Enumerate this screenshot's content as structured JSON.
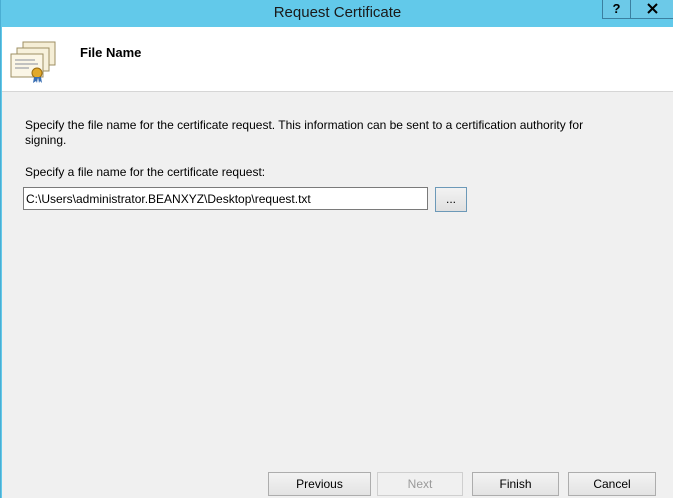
{
  "window": {
    "title": "Request Certificate",
    "help_label": "?"
  },
  "header": {
    "title": "File Name",
    "icon": "certificate-icon"
  },
  "content": {
    "description": "Specify the file name for the certificate request. This information can be sent to a certification authority for signing.",
    "field_label": "Specify a file name for the certificate request:",
    "file_path": "C:\\Users\\administrator.BEANXYZ\\Desktop\\request.txt",
    "browse_label": "..."
  },
  "footer": {
    "previous_label": "Previous",
    "next_label": "Next",
    "finish_label": "Finish",
    "cancel_label": "Cancel"
  },
  "colors": {
    "titlebar": "#62c9ea",
    "header_bg": "#ffffff",
    "body_bg": "#f0f0f0"
  }
}
